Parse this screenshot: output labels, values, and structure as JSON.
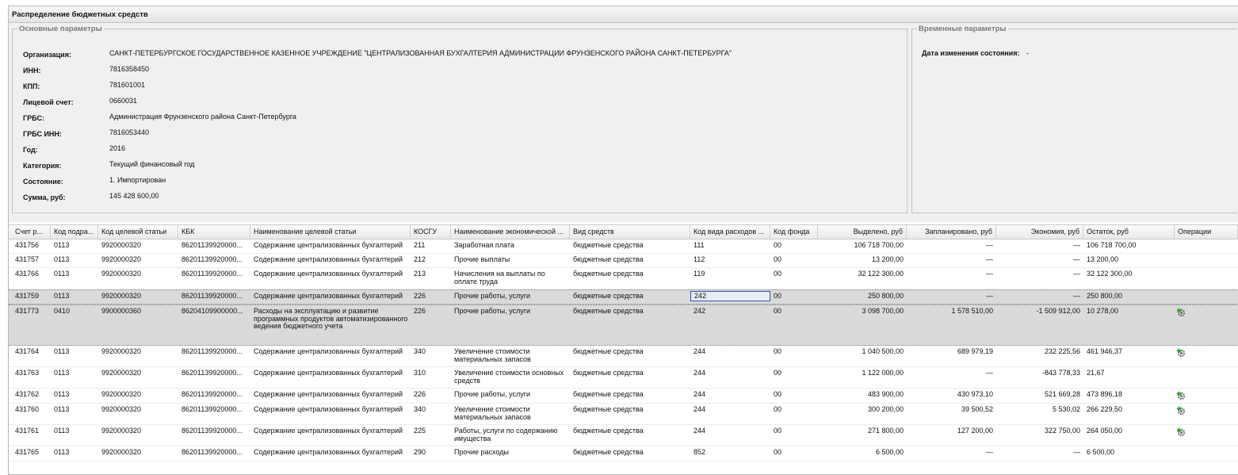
{
  "window": {
    "title": "Распределение бюджетных средств"
  },
  "main_params": {
    "legend": "Основные параметры",
    "fields": [
      {
        "label": "Организация:",
        "value": "САНКТ-ПЕТЕРБУРГСКОЕ ГОСУДАРСТВЕННОЕ КАЗЕННОЕ УЧРЕЖДЕНИЕ \"ЦЕНТРАЛИЗОВАННАЯ БУХГАЛТЕРИЯ АДМИНИСТРАЦИИ ФРУНЗЕНСКОГО РАЙОНА САНКТ-ПЕТЕРБУРГА\""
      },
      {
        "label": "ИНН:",
        "value": "7816358450"
      },
      {
        "label": "КПП:",
        "value": "781601001"
      },
      {
        "label": "Лицевой счет:",
        "value": "0660031"
      },
      {
        "label": "ГРБС:",
        "value": "Администрация Фрунзенского района Санкт-Петербурга"
      },
      {
        "label": "ГРБС ИНН:",
        "value": "7816053440"
      },
      {
        "label": "Год:",
        "value": "2016"
      },
      {
        "label": "Категория:",
        "value": "Текущий финансовый год"
      },
      {
        "label": "Состояние:",
        "value": "1. Импортирован"
      },
      {
        "label": "Сумма, руб:",
        "value": "145 428 600,00"
      }
    ]
  },
  "time_params": {
    "legend": "Временные параметры",
    "label": "Дата изменения состояния:",
    "value": "-"
  },
  "grid": {
    "columns": [
      "Счет р...",
      "Код подра...",
      "Код целевой статьи",
      "КБК",
      "Наименование целевой статьи",
      "КОСГУ",
      "Наименование экономической ...",
      "Вид средств",
      "Код вида расходов ...",
      "Код фонда",
      "Выделено, руб",
      "Запланировано, руб",
      "Экономия, руб",
      "Остаток, руб",
      "Операции"
    ],
    "rows": [
      {
        "acc": "431756",
        "sub": "0113",
        "tgt": "9920000320",
        "kbk": "86201139920000...",
        "tname": "Содержание централизованных бухгалтерий",
        "kosgu": "211",
        "ename": "Заработная плата",
        "kind": "бюджетные средства",
        "exp": "111",
        "fund": "00",
        "alloc": "106 718 700,00",
        "plan": "—",
        "econ": "—",
        "rest": "106 718 700,00",
        "op": false
      },
      {
        "acc": "431757",
        "sub": "0113",
        "tgt": "9920000320",
        "kbk": "86201139920000...",
        "tname": "Содержание централизованных бухгалтерий",
        "kosgu": "212",
        "ename": "Прочие выплаты",
        "kind": "бюджетные средства",
        "exp": "112",
        "fund": "00",
        "alloc": "13 200,00",
        "plan": "—",
        "econ": "—",
        "rest": "13 200,00",
        "op": false
      },
      {
        "acc": "431766",
        "sub": "0113",
        "tgt": "9920000320",
        "kbk": "86201139920000...",
        "tname": "Содержание централизованных бухгалтерий",
        "kosgu": "213",
        "ename": "Начисления на выплаты по оплате труда",
        "kind": "бюджетные средства",
        "exp": "119",
        "fund": "00",
        "alloc": "32 122 300,00",
        "plan": "—",
        "econ": "—",
        "rest": "32 122 300,00",
        "op": false
      },
      {
        "acc": "431759",
        "sub": "0113",
        "tgt": "9920000320",
        "kbk": "86201139920000...",
        "tname": "Содержание централизованных бухгалтерий",
        "kosgu": "226",
        "ename": "Прочие работы, услуги",
        "kind": "бюджетные средства",
        "exp": "242",
        "fund": "00",
        "alloc": "250 800,00",
        "plan": "—",
        "econ": "—",
        "rest": "250 800,00",
        "op": false
      },
      {
        "acc": "431773",
        "sub": "0410",
        "tgt": "9900000360",
        "kbk": "86204109900000...",
        "tname": "Расходы на эксплуатацию и развитие программных продуктов автоматизированного ведения бюджетного учета",
        "kosgu": "226",
        "ename": "Прочие работы, услуги",
        "kind": "бюджетные средства",
        "exp": "242",
        "fund": "00",
        "alloc": "3 098 700,00",
        "plan": "1 578 510,00",
        "econ": "-1 509 912,00",
        "rest": "10 278,00",
        "op": true
      },
      {
        "acc": "431764",
        "sub": "0113",
        "tgt": "9920000320",
        "kbk": "86201139920000...",
        "tname": "Содержание централизованных бухгалтерий",
        "kosgu": "340",
        "ename": "Увеличение стоимости материальных запасов",
        "kind": "бюджетные средства",
        "exp": "244",
        "fund": "00",
        "alloc": "1 040 500,00",
        "plan": "689 979,19",
        "econ": "232 225,56",
        "rest": "461 946,37",
        "op": true
      },
      {
        "acc": "431763",
        "sub": "0113",
        "tgt": "9920000320",
        "kbk": "86201139920000...",
        "tname": "Содержание централизованных бухгалтерий",
        "kosgu": "310",
        "ename": "Увеличение стоимости основных средств",
        "kind": "бюджетные средства",
        "exp": "244",
        "fund": "00",
        "alloc": "1 122 000,00",
        "plan": "—",
        "econ": "-843 778,33",
        "rest": "21,67",
        "op": false
      },
      {
        "acc": "431762",
        "sub": "0113",
        "tgt": "9920000320",
        "kbk": "86201139920000...",
        "tname": "Содержание централизованных бухгалтерий",
        "kosgu": "226",
        "ename": "Прочие работы, услуги",
        "kind": "бюджетные средства",
        "exp": "244",
        "fund": "00",
        "alloc": "483 900,00",
        "plan": "430 973,10",
        "econ": "521 669,28",
        "rest": "473 896,18",
        "op": true
      },
      {
        "acc": "431760",
        "sub": "0113",
        "tgt": "9920000320",
        "kbk": "86201139920000...",
        "tname": "Содержание централизованных бухгалтерий",
        "kosgu": "340",
        "ename": "Увеличение стоимости материальных запасов",
        "kind": "бюджетные средства",
        "exp": "244",
        "fund": "00",
        "alloc": "300 200,00",
        "plan": "39 500,52",
        "econ": "5 530,02",
        "rest": "266 229,50",
        "op": true
      },
      {
        "acc": "431761",
        "sub": "0113",
        "tgt": "9920000320",
        "kbk": "86201139920000...",
        "tname": "Содержание централизованных бухгалтерий",
        "kosgu": "225",
        "ename": "Работы, услуги по содержанию имущества",
        "kind": "бюджетные средства",
        "exp": "244",
        "fund": "00",
        "alloc": "271 800,00",
        "plan": "127 200,00",
        "econ": "322 750,00",
        "rest": "264 050,00",
        "op": true
      },
      {
        "acc": "431765",
        "sub": "0113",
        "tgt": "9920000320",
        "kbk": "86201139920000...",
        "tname": "Содержание централизованных бухгалтерий",
        "kosgu": "290",
        "ename": "Прочие расходы",
        "kind": "бюджетные средства",
        "exp": "852",
        "fund": "00",
        "alloc": "6 500,00",
        "plan": "—",
        "econ": "—",
        "rest": "6 500,00",
        "op": false
      }
    ]
  },
  "icons": {
    "operation": "gear-arrow-icon"
  },
  "colors": {
    "selected_row": "#dadada",
    "active_cell_border": "#3355aa",
    "icon_green": "#3aa336"
  }
}
